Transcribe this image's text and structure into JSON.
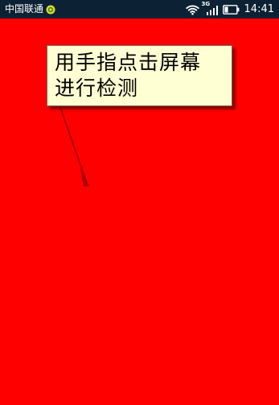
{
  "status_bar": {
    "carrier": "中国联通",
    "notification_icon": "app-notification-icon",
    "wifi_icon": "wifi-icon",
    "network_type": "3G",
    "signal_icon": "signal-bars-icon",
    "battery_icon": "battery-icon",
    "time": "14:41"
  },
  "screen": {
    "background_color": "#ff0000"
  },
  "tooltip": {
    "line1": "用手指点击屏幕",
    "line2": "进行检测"
  }
}
